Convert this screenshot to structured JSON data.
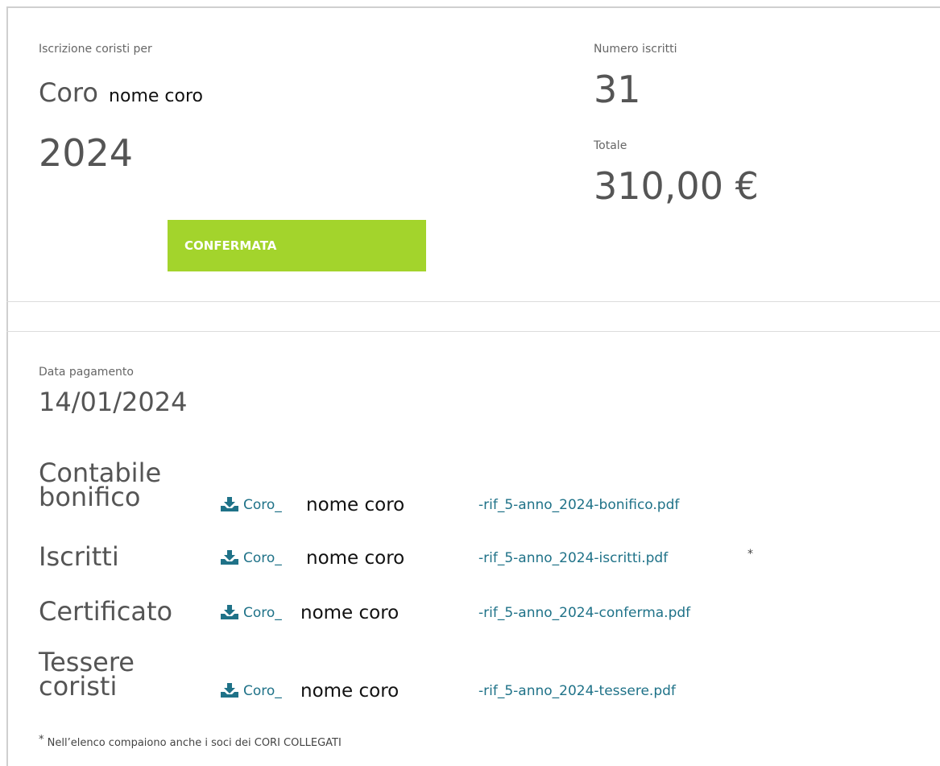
{
  "header": {
    "subtitle": "Iscrizione coristi per",
    "coro_word": "Coro",
    "choir_name": "nome coro",
    "year": "2024",
    "status_label": "CONFERMATA",
    "status_color": "#a3d42c"
  },
  "stats": {
    "numero_label": "Numero iscritti",
    "numero_value": "31",
    "totale_label": "Totale",
    "totale_value": "310,00 €"
  },
  "payment": {
    "date_label": "Data pagamento",
    "date_value": "14/01/2024"
  },
  "documents": [
    {
      "label": "Contabile bonifico",
      "link_prefix": "Coro_",
      "choir_name": "nome coro",
      "link_suffix": "-rif_5-anno_2024-bonifico.pdf",
      "icon": "download-icon"
    },
    {
      "label": "Iscritti",
      "link_prefix": "Coro_",
      "choir_name": "nome coro",
      "link_suffix": "-rif_5-anno_2024-iscritti.pdf",
      "asterisk": "*",
      "icon": "download-icon"
    },
    {
      "label": "Certificato",
      "link_prefix": "Coro_",
      "choir_name": "nome coro",
      "link_suffix": "-rif_5-anno_2024-conferma.pdf",
      "icon": "download-icon"
    },
    {
      "label": "Tessere coristi",
      "link_prefix": "Coro_",
      "choir_name": "nome coro",
      "link_suffix": "-rif_5-anno_2024-tessere.pdf",
      "icon": "download-icon"
    }
  ],
  "footnote": {
    "mark": "*",
    "text": "Nell’elenco compaiono anche i soci dei CORI COLLEGATI"
  },
  "colors": {
    "link": "#1f7288",
    "text": "#555555",
    "border": "#cfcfcf"
  }
}
